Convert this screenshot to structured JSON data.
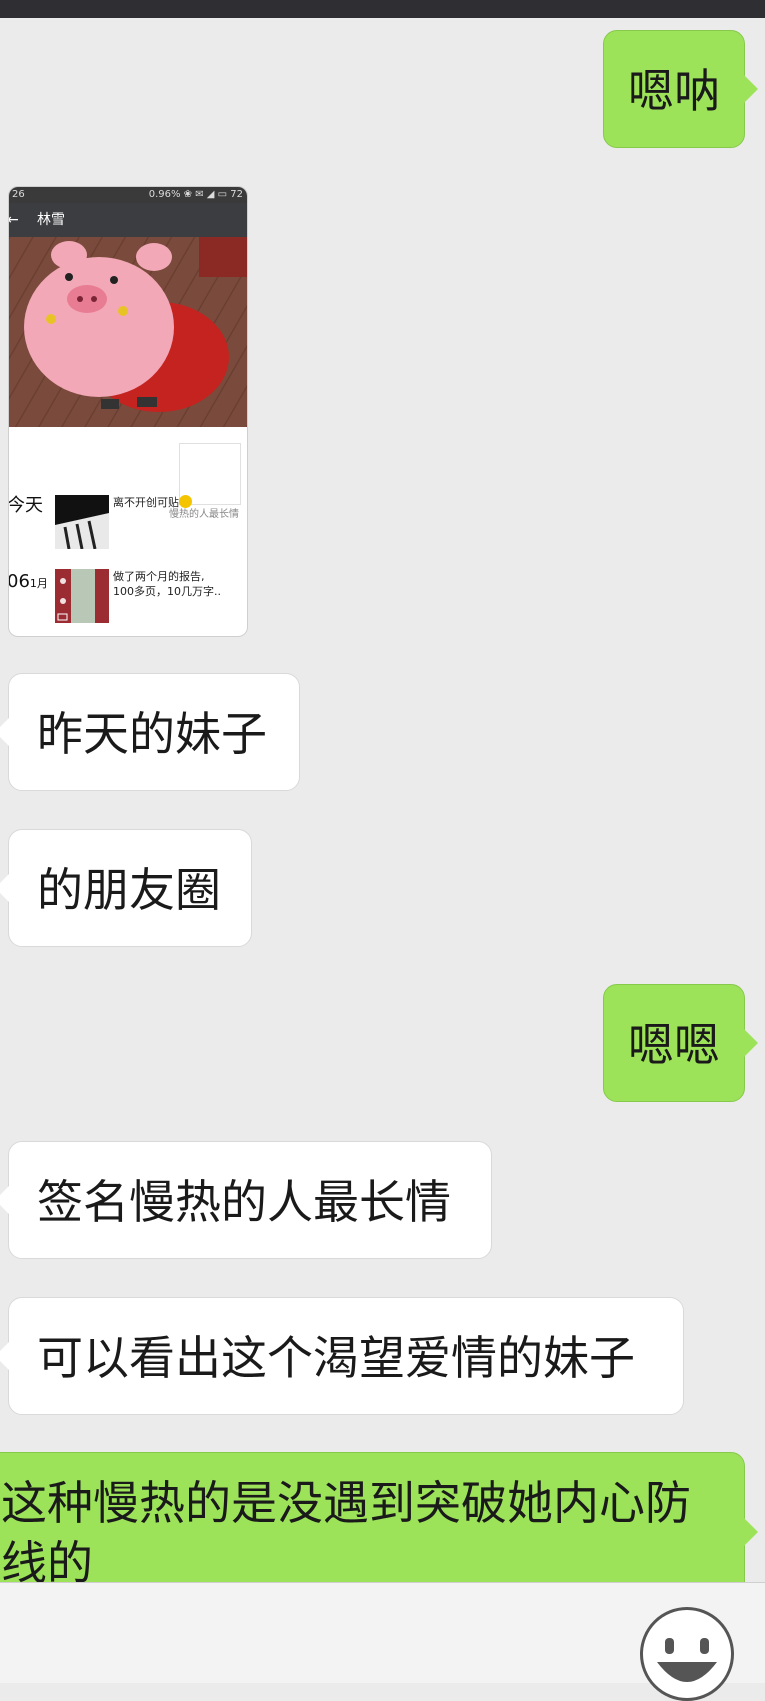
{
  "conversation": {
    "contact_screenshot": {
      "status_time": "26",
      "status_right": "0.96% ❀ ✉ ◢ ▭ 72",
      "back_glyph": "←",
      "contact_name": "林雪",
      "signature": "慢热的人最长情",
      "posts": [
        {
          "date_main": "今天",
          "date_small": "",
          "text": "离不开创可贴"
        },
        {
          "date_main": "06",
          "date_small": "1月",
          "text_line1": "做了两个月的报告,",
          "text_line2": "100多页，10几万字.."
        }
      ]
    },
    "messages": [
      {
        "side": "right",
        "text": "嗯呐"
      },
      {
        "side": "left",
        "text": "昨天的妹子"
      },
      {
        "side": "left",
        "text": "的朋友圈"
      },
      {
        "side": "right",
        "text": "嗯嗯"
      },
      {
        "side": "left",
        "text": "签名慢热的人最长情"
      },
      {
        "side": "left",
        "text": "可以看出这个渴望爱情的妹子"
      },
      {
        "side": "right",
        "text_line1": "这种慢热的是没遇到突破她内心防",
        "text_line2": "线的"
      }
    ]
  },
  "input_bar": {
    "emoji_icon": "smiley-face-icon"
  },
  "colors": {
    "background": "#ebebeb",
    "sent_bubble": "#9de35a",
    "received_bubble": "#ffffff"
  }
}
